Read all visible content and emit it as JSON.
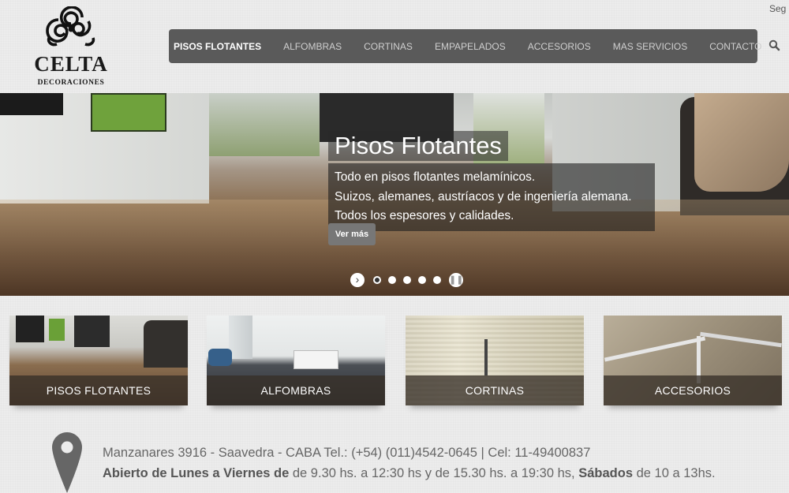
{
  "topbar": {
    "link": "Seg"
  },
  "logo": {
    "word": "CELTA",
    "sub": "DECORACIONES"
  },
  "nav": {
    "items": [
      "PISOS FLOTANTES",
      "ALFOMBRAS",
      "CORTINAS",
      "EMPAPELADOS",
      "ACCESORIOS",
      "MAS SERVICIOS",
      "CONTACTO"
    ],
    "active_index": 0
  },
  "hero": {
    "title": "Pisos Flotantes",
    "lines": [
      "Todo en pisos flotantes melamínicos.",
      "Suizos, alemanes, austríacos y de ingeniería alemana.",
      "Todos los espesores y calidades."
    ],
    "button": "Ver más",
    "slides_count": 6,
    "active_slide": 1
  },
  "categories": [
    {
      "label": "PISOS FLOTANTES"
    },
    {
      "label": "ALFOMBRAS"
    },
    {
      "label": "CORTINAS"
    },
    {
      "label": "ACCESORIOS"
    }
  ],
  "footer": {
    "address": "Manzanares 3916 - Saavedra - CABA Tel.: (+54) (011)4542-0645 | Cel: 11-49400837",
    "hours_bold1": "Abierto de Lunes a Viernes de",
    "hours_text1": " de 9.30 hs. a 12:30 hs y de 15.30 hs. a 19:30 hs, ",
    "hours_bold2": "Sábados",
    "hours_text2": " de 10 a 13hs."
  },
  "colors": {
    "nav_bg": "#5a5a5a",
    "caption_bg": "#373028",
    "text_gray": "#666666"
  },
  "icons": [
    "celta-triskele-logo-icon",
    "search-icon",
    "chevron-right-icon",
    "pause-icon",
    "map-pin-icon"
  ]
}
